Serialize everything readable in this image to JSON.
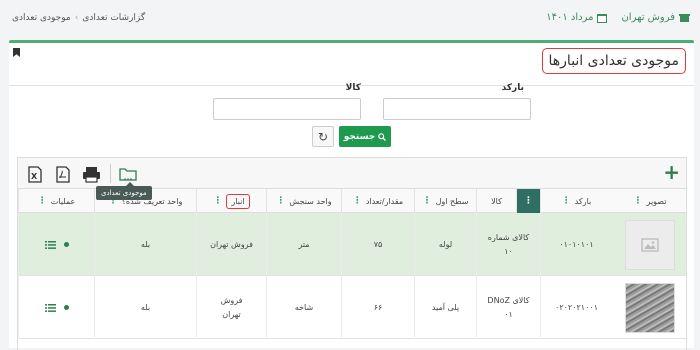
{
  "topbar": {
    "app_name": "فروش تهران",
    "date_label": "مرداد ۱۴۰۱",
    "breadcrumb": [
      "گزارشات تعدادی",
      "موجودی تعدادی"
    ]
  },
  "page": {
    "title": "موجودی تعدادی انبارها"
  },
  "filters": {
    "barcode_label": "بارکد",
    "product_label": "کالا",
    "search_label": "جستجو"
  },
  "toolbar": {
    "tooltip": "موجودی تعدادی"
  },
  "table": {
    "columns": [
      "تصویر",
      "بارکد",
      "کالا",
      "سطح اول",
      "مقدار/تعداد",
      "واحد سنجش",
      "انبار",
      "واحد تعریف شده؟",
      "عملیات"
    ],
    "rows": [
      {
        "barcode": "۰۱۰۱۰۱۰۱",
        "product": "کالای شماره ۱۰",
        "level1": "لوله",
        "qty": "۷۵",
        "unit": "متر",
        "warehouse": "فروش تهران",
        "defined": "بله"
      },
      {
        "barcode": "۰۲۰۲۰۲۱۰۰۱",
        "product": "کالای DNoZ ۰۱",
        "level1": "پلی آمید",
        "qty": "۶۶",
        "unit": "شاخه",
        "warehouse": "فروش تهران",
        "defined": "بله"
      }
    ]
  },
  "colors": {
    "accent": "#2e7d4f",
    "selected_row": "#dfeedd",
    "highlight_border": "#e03a3a"
  }
}
